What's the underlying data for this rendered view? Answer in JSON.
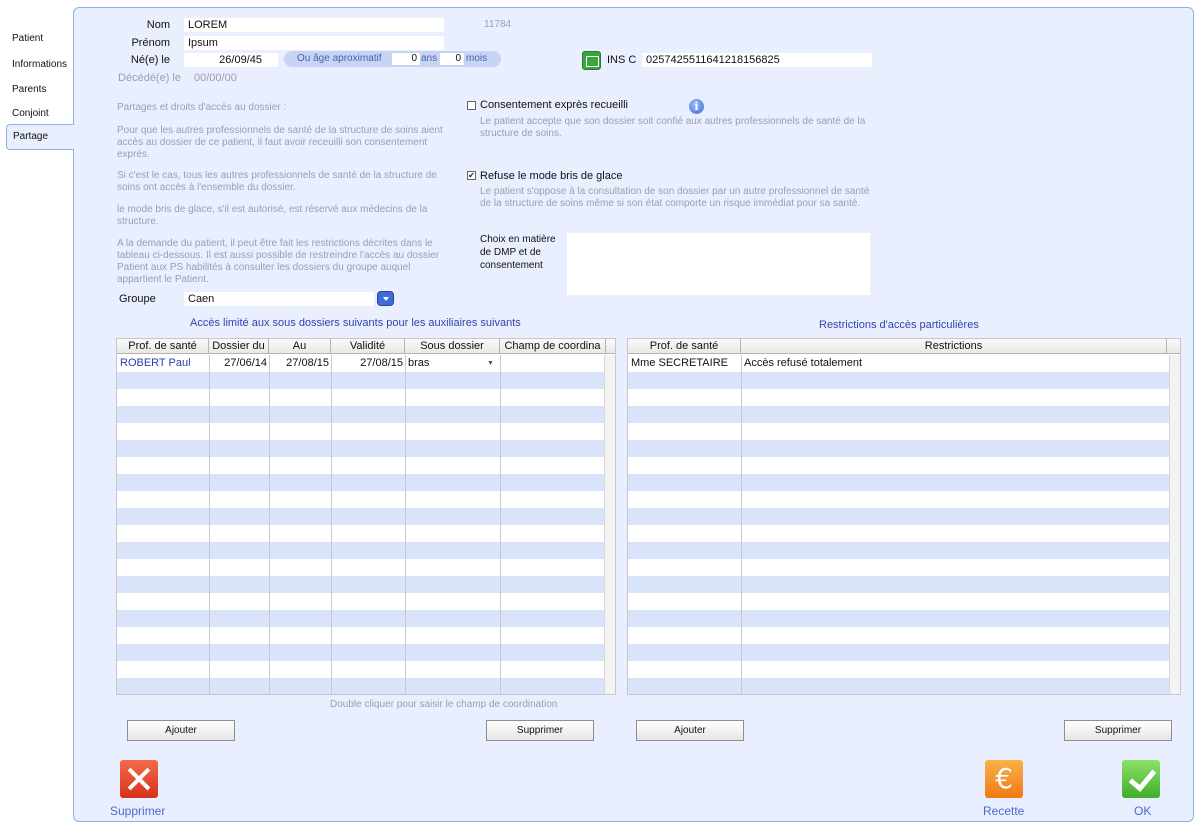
{
  "tabs": [
    "Patient",
    "Informations",
    "Parents",
    "Conjoint",
    "Partage"
  ],
  "identity": {
    "nom_label": "Nom",
    "nom": "LOREM",
    "id": "11784",
    "prenom_label": "Prénom",
    "prenom": "Ipsum",
    "nele_label": "Né(e) le",
    "nele": "26/09/45",
    "age_label": "Ou âge aproximatif",
    "age_years": "0",
    "ans_label": "ans",
    "age_months": "0",
    "mois_label": "mois",
    "decede_label": "Décédé(e) le",
    "decede": "00/00/00",
    "insc_label": "INS C",
    "insc": "0257425511641218156825"
  },
  "info_text": {
    "p1": "Partages et droits d'accès au dossier :",
    "p2": "Pour que les autres professionnels de santé de la structure de soins aient accès au dossier de ce patient, il faut avoir receuilli son consentement exprès.",
    "p3": "Si c'est le cas, tous les autres professionnels de santé de la structure de soins ont accès à l'ensemble du dossier.",
    "p4": "le mode bris de glace, s'il est autorisé, est réservé aux médecins de la structure.",
    "p5": "A la demande du patient, il peut être fait les restrictions décrites dans le tableau ci-dessous. Il est aussi possible de restreindre l'accès au dossier Patient aux PS habilités à consulter les dossiers du groupe auquel appartient le Patient."
  },
  "consent": {
    "label": "Consentement exprès recueilli",
    "checked": "",
    "desc": "Le patient accepte que son dossier soit confié  aux autres professionnels de santé de la structure de soins."
  },
  "bris": {
    "label": "Refuse le mode bris de glace",
    "checked": "✔",
    "desc": "Le patient s'oppose à la consultation de son dossier par un autre professionnel de santé de la structure de soins même si son état comporte un risque immédiat pour sa santé."
  },
  "choix_label": "Choix en matière de DMP et de consentement",
  "groupe": {
    "label": "Groupe",
    "value": "Caen"
  },
  "left_table": {
    "caption": "Accès limité aux sous dossiers suivants pour les auxiliaires suivants",
    "headers": [
      "Prof. de santé",
      "Dossier du",
      "Au",
      "Validité",
      "Sous dossier",
      "Champ de coordina"
    ],
    "row": [
      "ROBERT Paul",
      "27/06/14",
      "27/08/15",
      "27/08/15",
      "bras",
      ""
    ],
    "hint": "Double cliquer pour saisir le champ de coordination",
    "add": "Ajouter",
    "remove": "Supprimer"
  },
  "right_table": {
    "caption": "Restrictions d'accès particulières",
    "headers": [
      "Prof. de santé",
      "Restrictions"
    ],
    "row": [
      "Mme SECRETAIRE",
      "Accès refusé totalement"
    ],
    "add": "Ajouter",
    "remove": "Supprimer"
  },
  "footer": {
    "delete": "Supprimer",
    "recette": "Recette",
    "ok": "OK"
  }
}
